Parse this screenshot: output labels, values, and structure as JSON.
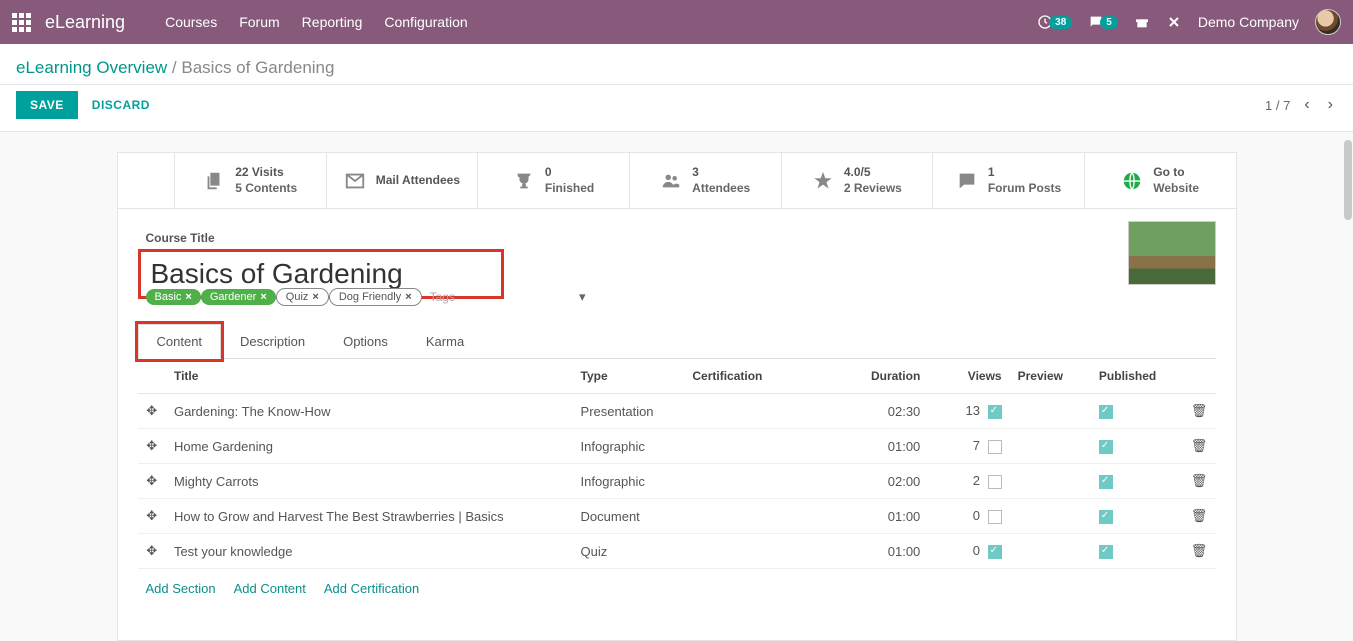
{
  "topbar": {
    "brand": "eLearning",
    "nav": [
      "Courses",
      "Forum",
      "Reporting",
      "Configuration"
    ],
    "clock_badge": "38",
    "chat_badge": "5",
    "company": "Demo Company"
  },
  "breadcrumb": {
    "root": "eLearning Overview",
    "sep": " / ",
    "current": "Basics of Gardening"
  },
  "actions": {
    "save": "SAVE",
    "discard": "DISCARD",
    "pager": "1 / 7"
  },
  "stats": {
    "visits_line1": "22 Visits",
    "visits_line2": "5 Contents",
    "mail": "Mail Attendees",
    "finished_n": "0",
    "finished_l": "Finished",
    "attendees_n": "3",
    "attendees_l": "Attendees",
    "rating_n": "4.0/5",
    "rating_l": "2 Reviews",
    "forum_n": "1",
    "forum_l": "Forum Posts",
    "go_l1": "Go to",
    "go_l2": "Website"
  },
  "form": {
    "title_label": "Course Title",
    "title_value": "Basics of Gardening",
    "tags": [
      {
        "label": "Basic",
        "style": "green"
      },
      {
        "label": "Gardener",
        "style": "green"
      },
      {
        "label": "Quiz",
        "style": "outline"
      },
      {
        "label": "Dog Friendly",
        "style": "outline"
      }
    ],
    "tags_placeholder": "Tags"
  },
  "tabs": [
    "Content",
    "Description",
    "Options",
    "Karma"
  ],
  "table": {
    "headers": {
      "title": "Title",
      "type": "Type",
      "cert": "Certification",
      "dur": "Duration",
      "views": "Views",
      "preview": "Preview",
      "pub": "Published"
    },
    "rows": [
      {
        "title": "Gardening: The Know-How",
        "type": "Presentation",
        "dur": "02:30",
        "views": "13",
        "preview": true,
        "pub": true
      },
      {
        "title": "Home Gardening",
        "type": "Infographic",
        "dur": "01:00",
        "views": "7",
        "preview": false,
        "pub": true
      },
      {
        "title": "Mighty Carrots",
        "type": "Infographic",
        "dur": "02:00",
        "views": "2",
        "preview": false,
        "pub": true
      },
      {
        "title": "How to Grow and Harvest The Best Strawberries | Basics",
        "type": "Document",
        "dur": "01:00",
        "views": "0",
        "preview": false,
        "pub": true
      },
      {
        "title": "Test your knowledge",
        "type": "Quiz",
        "dur": "01:00",
        "views": "0",
        "preview": true,
        "pub": true
      }
    ],
    "add": {
      "section": "Add Section",
      "content": "Add Content",
      "cert": "Add Certification"
    }
  }
}
